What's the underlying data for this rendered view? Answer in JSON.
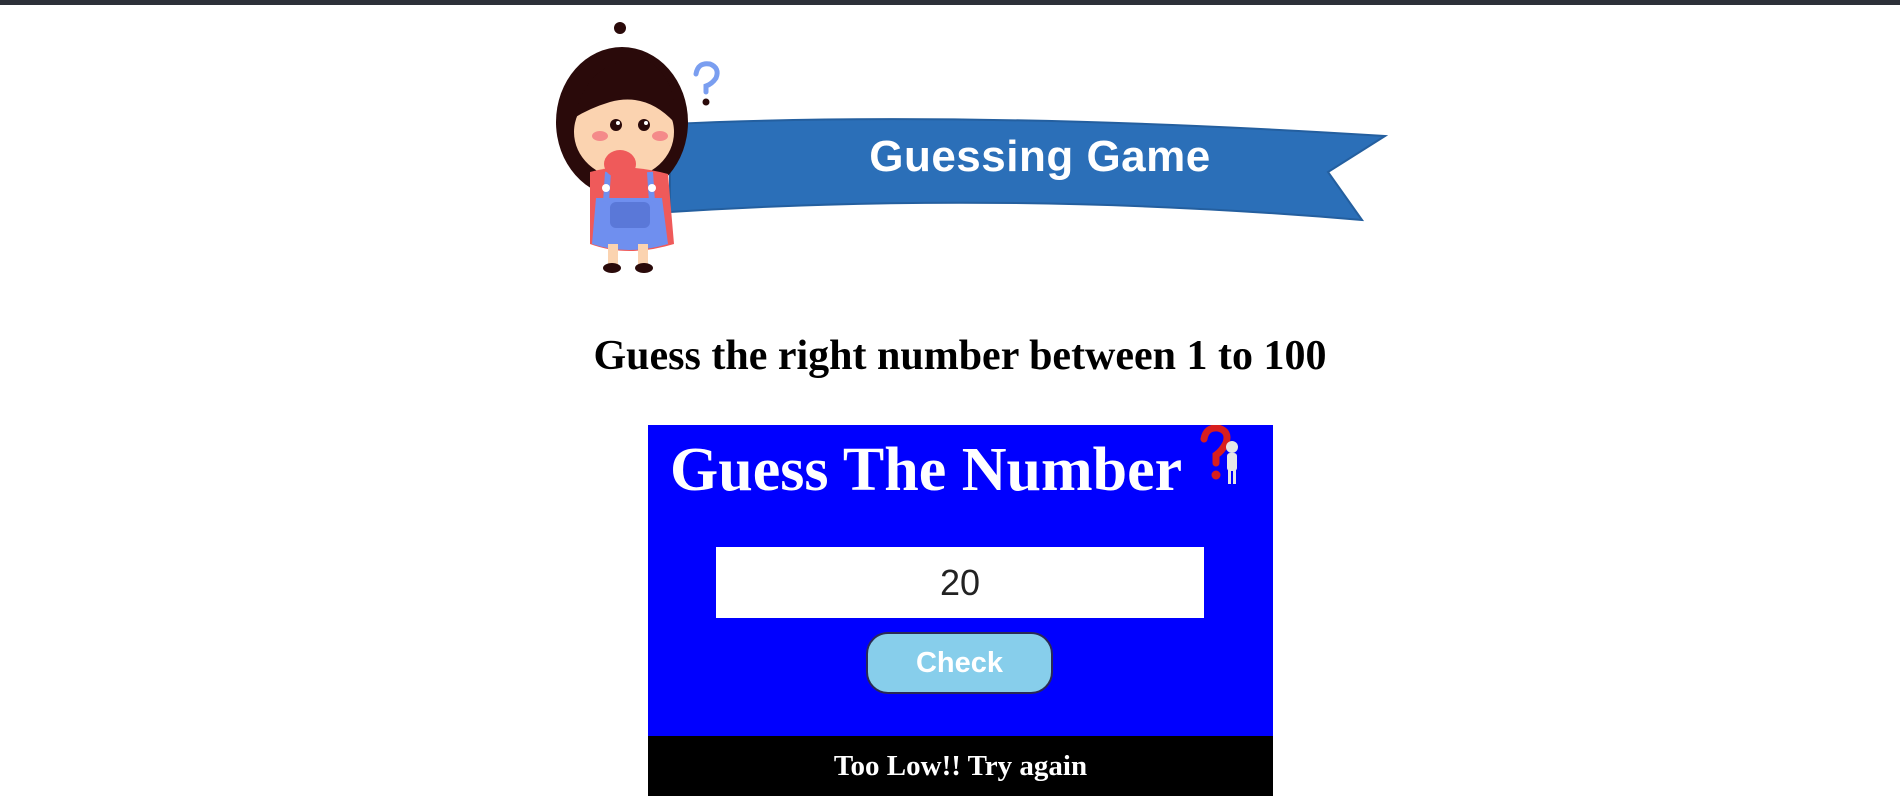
{
  "banner": {
    "title": "Guessing Game"
  },
  "instructions": "Guess the right number between 1 to 100",
  "game": {
    "title": "Guess The Number",
    "input_value": "20",
    "check_label": "Check",
    "message": "Too Low!! Try again"
  },
  "icons": {
    "mascot": "thinking-girl-icon",
    "banner_question": "question-mark-icon",
    "title_question": "person-question-mark-icon"
  },
  "colors": {
    "banner_blue": "#2b6fb8",
    "game_bg": "#0000ff",
    "button_bg": "#87ceeb",
    "message_bg": "#000000"
  }
}
